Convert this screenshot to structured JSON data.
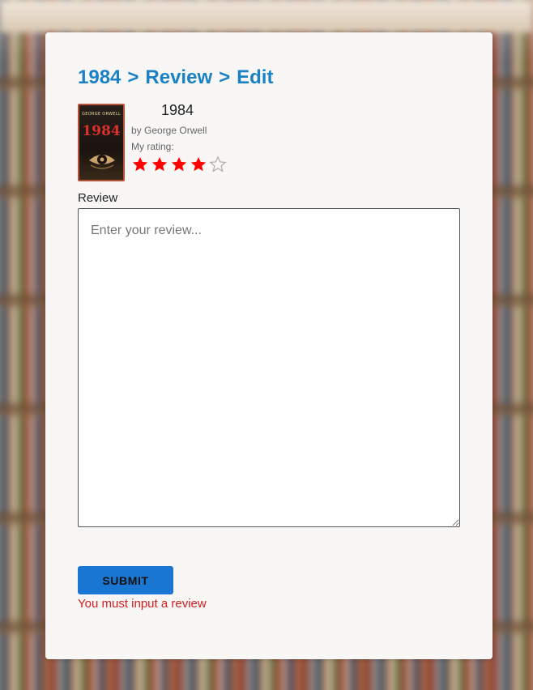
{
  "breadcrumb": {
    "items": [
      "1984",
      "Review",
      "Edit"
    ],
    "separator": ">"
  },
  "book": {
    "title": "1984",
    "author_line": "by George Orwell",
    "cover_author": "GEORGE ORWELL",
    "cover_title": "1984"
  },
  "rating": {
    "label": "My rating:",
    "value": 4,
    "max": 5,
    "filled_color": "#ff0000",
    "empty_color": "#b0b0b0"
  },
  "review": {
    "label": "Review",
    "value": "",
    "placeholder": "Enter your review..."
  },
  "submit": {
    "label": "SUBMIT"
  },
  "error": {
    "message": "You must input a review"
  },
  "colors": {
    "accent": "#1a82c4",
    "button": "#1976d2",
    "error": "#d81b1b"
  }
}
